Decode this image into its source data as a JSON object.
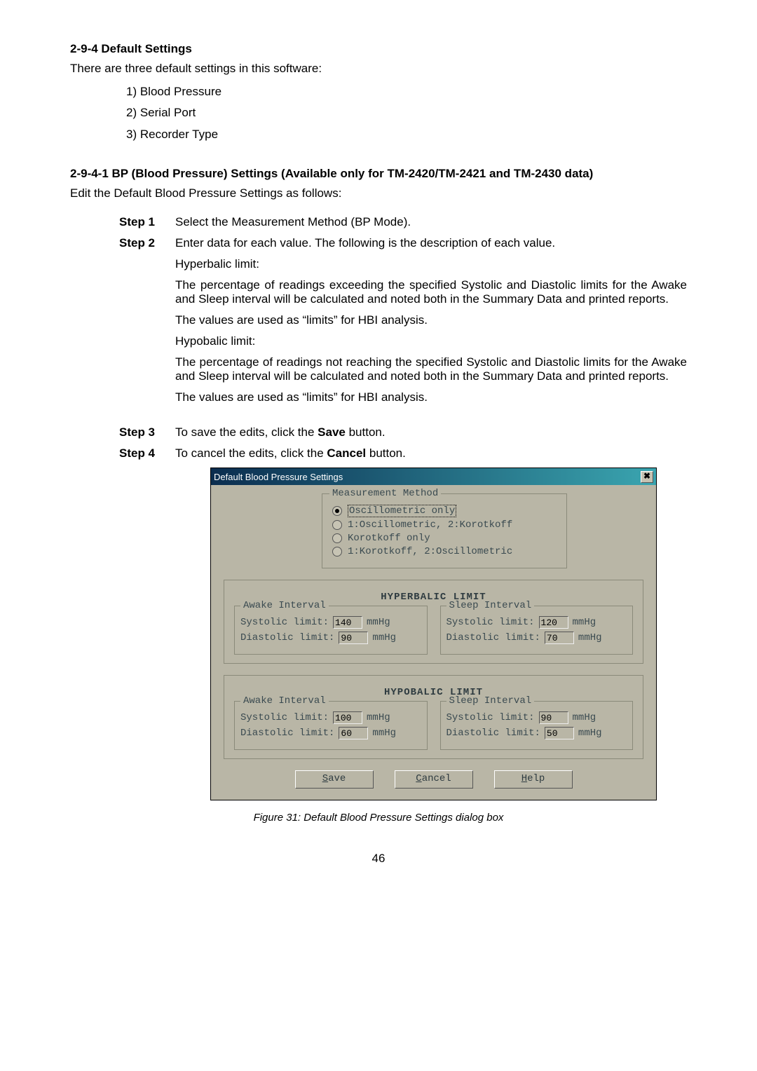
{
  "doc": {
    "h1": "2-9-4 Default Settings",
    "intro": "There are three default settings in this software:",
    "items": {
      "i1": "1)  Blood Pressure",
      "i2": "2)  Serial Port",
      "i3": "3)  Recorder Type"
    },
    "h2": "2-9-4-1 BP (Blood Pressure) Settings (Available only for TM-2420/TM-2421 and TM-2430 data)",
    "intro2": "Edit the Default Blood Pressure Settings as follows:",
    "step1_label": "Step 1",
    "step1_body": "Select the Measurement Method (BP Mode).",
    "step2_label": "Step 2",
    "step2_intro": "Enter data for each value. The following is the description of each value.",
    "hyper_label": "Hyperbalic limit:",
    "hyper_body1": "The percentage of readings exceeding the specified Systolic and Diastolic limits for the Awake and Sleep interval will be calculated and noted both in the Summary Data and printed reports.",
    "hyper_body2": "The values are used as “limits” for HBI analysis.",
    "hypo_label": "Hypobalic limit:",
    "hypo_body1": "The percentage of readings not reaching the specified Systolic and Diastolic limits for the Awake and Sleep interval will be calculated and noted both in the Summary Data and printed reports.",
    "hypo_body2": "The values are used as “limits” for HBI analysis.",
    "step3_label": "Step 3",
    "step3_pre": "To save the edits, click the ",
    "step3_bold": "Save",
    "step3_post": " button.",
    "step4_label": "Step 4",
    "step4_pre": "To cancel the edits, click the ",
    "step4_bold": "Cancel",
    "step4_post": " button.",
    "caption": "Figure 31: Default Blood Pressure Settings dialog box",
    "page_num": "46"
  },
  "dialog": {
    "title": "Default Blood Pressure Settings",
    "close": "✖",
    "mm_title": "Measurement Method",
    "opt1": "Oscillometric only",
    "opt2": "1:Oscillometric, 2:Korotkoff",
    "opt3": "Korotkoff only",
    "opt4": "1:Korotkoff, 2:Oscillometric",
    "hyper_heading": "HYPERBALIC LIMIT",
    "hypo_heading": "HYPOBALIC LIMIT",
    "awake_title": "Awake Interval",
    "sleep_title": "Sleep Interval",
    "systolic_label": "Systolic limit:",
    "diastolic_label": "Diastolic limit:",
    "unit": "mmHg",
    "hyper_awake_sys": "140",
    "hyper_awake_dia": "90",
    "hyper_sleep_sys": "120",
    "hyper_sleep_dia": "70",
    "hypo_awake_sys": "100",
    "hypo_awake_dia": "60",
    "hypo_sleep_sys": "90",
    "hypo_sleep_dia": "50",
    "save_u": "S",
    "save_rest": "ave",
    "cancel_u": "C",
    "cancel_rest": "ancel",
    "help_u": "H",
    "help_rest": "elp"
  }
}
